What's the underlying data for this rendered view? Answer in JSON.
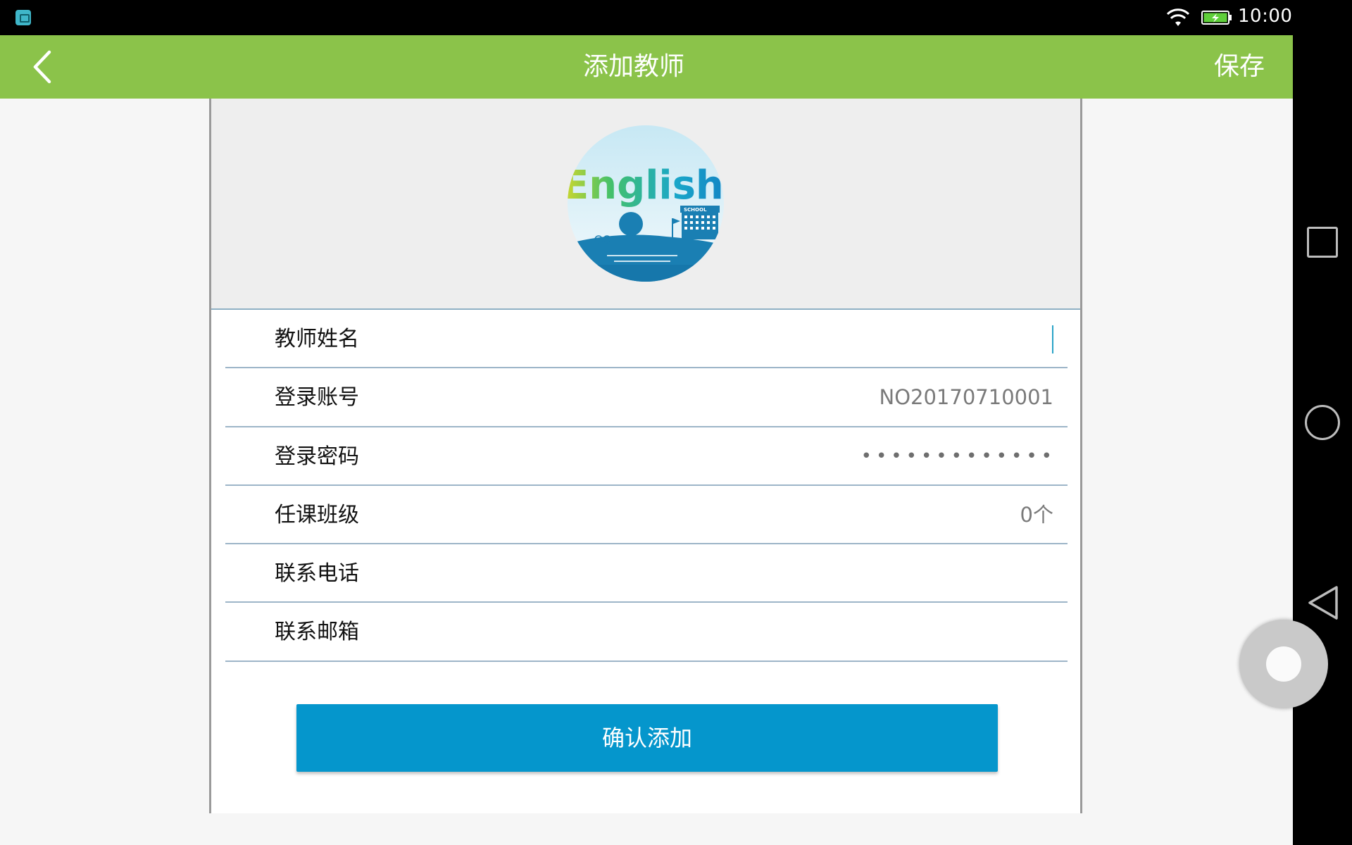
{
  "status_bar": {
    "time": "10:00",
    "app_icon": "android-app-icon",
    "wifi_icon": "wifi-icon",
    "battery_icon": "battery-charging-icon"
  },
  "appbar": {
    "back_icon": "chevron-left-icon",
    "title": "添加教师",
    "save_label": "保存",
    "color": "#8bc34a"
  },
  "avatar": {
    "brand_text": "English",
    "tag_text": "SCHOOL"
  },
  "form": {
    "rows": [
      {
        "label": "教师姓名",
        "value": ""
      },
      {
        "label": "登录账号",
        "value": "NO20170710001"
      },
      {
        "label": "登录密码",
        "value": "•••••••••••••"
      },
      {
        "label": "任课班级",
        "value": "0个"
      },
      {
        "label": "联系电话",
        "value": ""
      },
      {
        "label": "联系邮箱",
        "value": ""
      }
    ]
  },
  "confirm_button": {
    "label": "确认添加",
    "color": "#0596cc"
  },
  "nav_bar": {
    "recent_icon": "square-recent-apps-icon",
    "home_icon": "circle-home-icon",
    "back_icon": "triangle-back-icon"
  }
}
